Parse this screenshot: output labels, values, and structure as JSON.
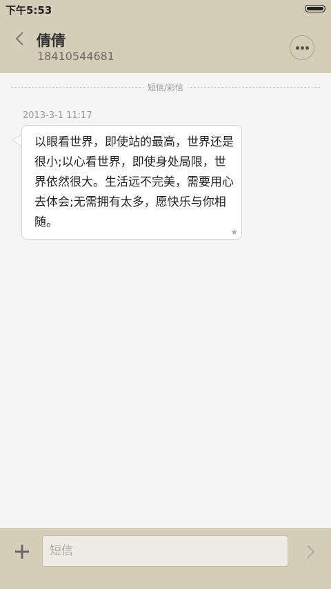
{
  "status_bar": {
    "time": "下午5:53"
  },
  "header": {
    "contact_name": "倩倩",
    "contact_number": "18410544681"
  },
  "conversation": {
    "divider_label": "短信/彩信",
    "messages": [
      {
        "timestamp": "2013-3-1 11:17",
        "text": "以眼看世界，即使站的最高，世界还是很小;以心看世界，即使身处局限，世界依然很大。生活远不完美，需要用心去体会;无需拥有太多，愿快乐与你相随。",
        "starred": true,
        "star_glyph": "★"
      }
    ]
  },
  "composer": {
    "placeholder": "短信"
  },
  "colors": {
    "bar_background": "#d4ceb9",
    "content_background": "#f5f5f5",
    "bubble_background": "#ffffff"
  },
  "icons": [
    "back-arrow-icon",
    "more-options-icon",
    "add-icon",
    "send-arrow-icon",
    "star-icon",
    "battery-icon"
  ]
}
